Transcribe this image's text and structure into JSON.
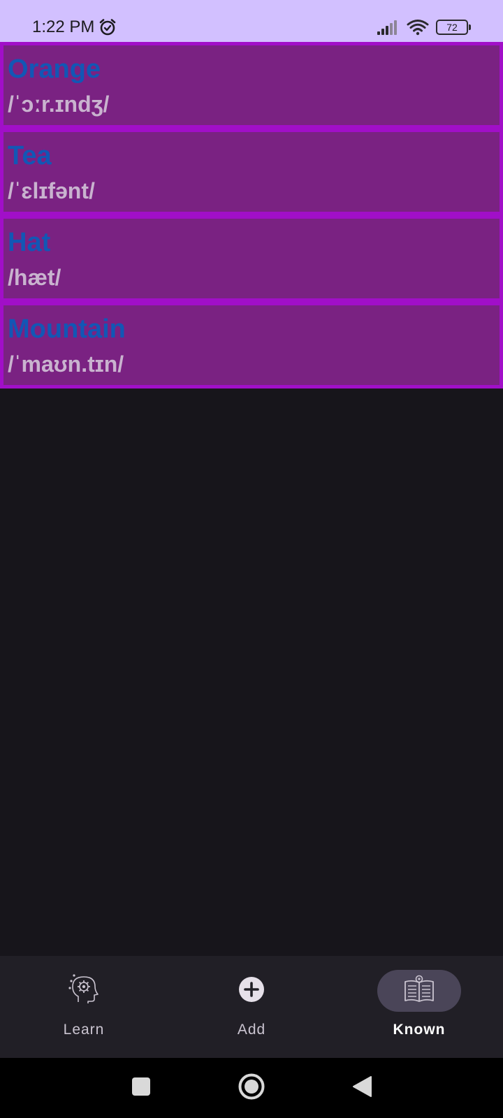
{
  "status_bar": {
    "time": "1:22 PM",
    "battery": "72",
    "icons": [
      "alarm-icon",
      "signal-icon",
      "wifi-icon",
      "battery-icon"
    ]
  },
  "words": [
    {
      "word": "Orange",
      "ipa": "/ˈɔːr.ɪndʒ/"
    },
    {
      "word": "Tea",
      "ipa": "/ˈɛlɪfənt/"
    },
    {
      "word": "Hat",
      "ipa": "/hæt/"
    },
    {
      "word": "Mountain",
      "ipa": "/ˈmaʊn.tɪn/"
    }
  ],
  "bottom_nav": {
    "learn": {
      "label": "Learn",
      "icon": "brain-gear-icon"
    },
    "add": {
      "label": "Add",
      "icon": "add-circle-icon"
    },
    "known": {
      "label": "Known",
      "icon": "open-book-icon",
      "selected": true
    }
  },
  "system_nav": {
    "icons": [
      "recents-icon",
      "home-icon",
      "back-icon"
    ]
  },
  "colors": {
    "status_bar_bg": "#d2c0ff",
    "card_bg": "#7a2282",
    "card_border": "#a10fc8",
    "word_color": "#1257b5",
    "ipa_color": "#c9b3cf",
    "screen_bg": "#17151b",
    "nav_bg": "#211f26",
    "nav_selected_pill": "#4a4558"
  }
}
